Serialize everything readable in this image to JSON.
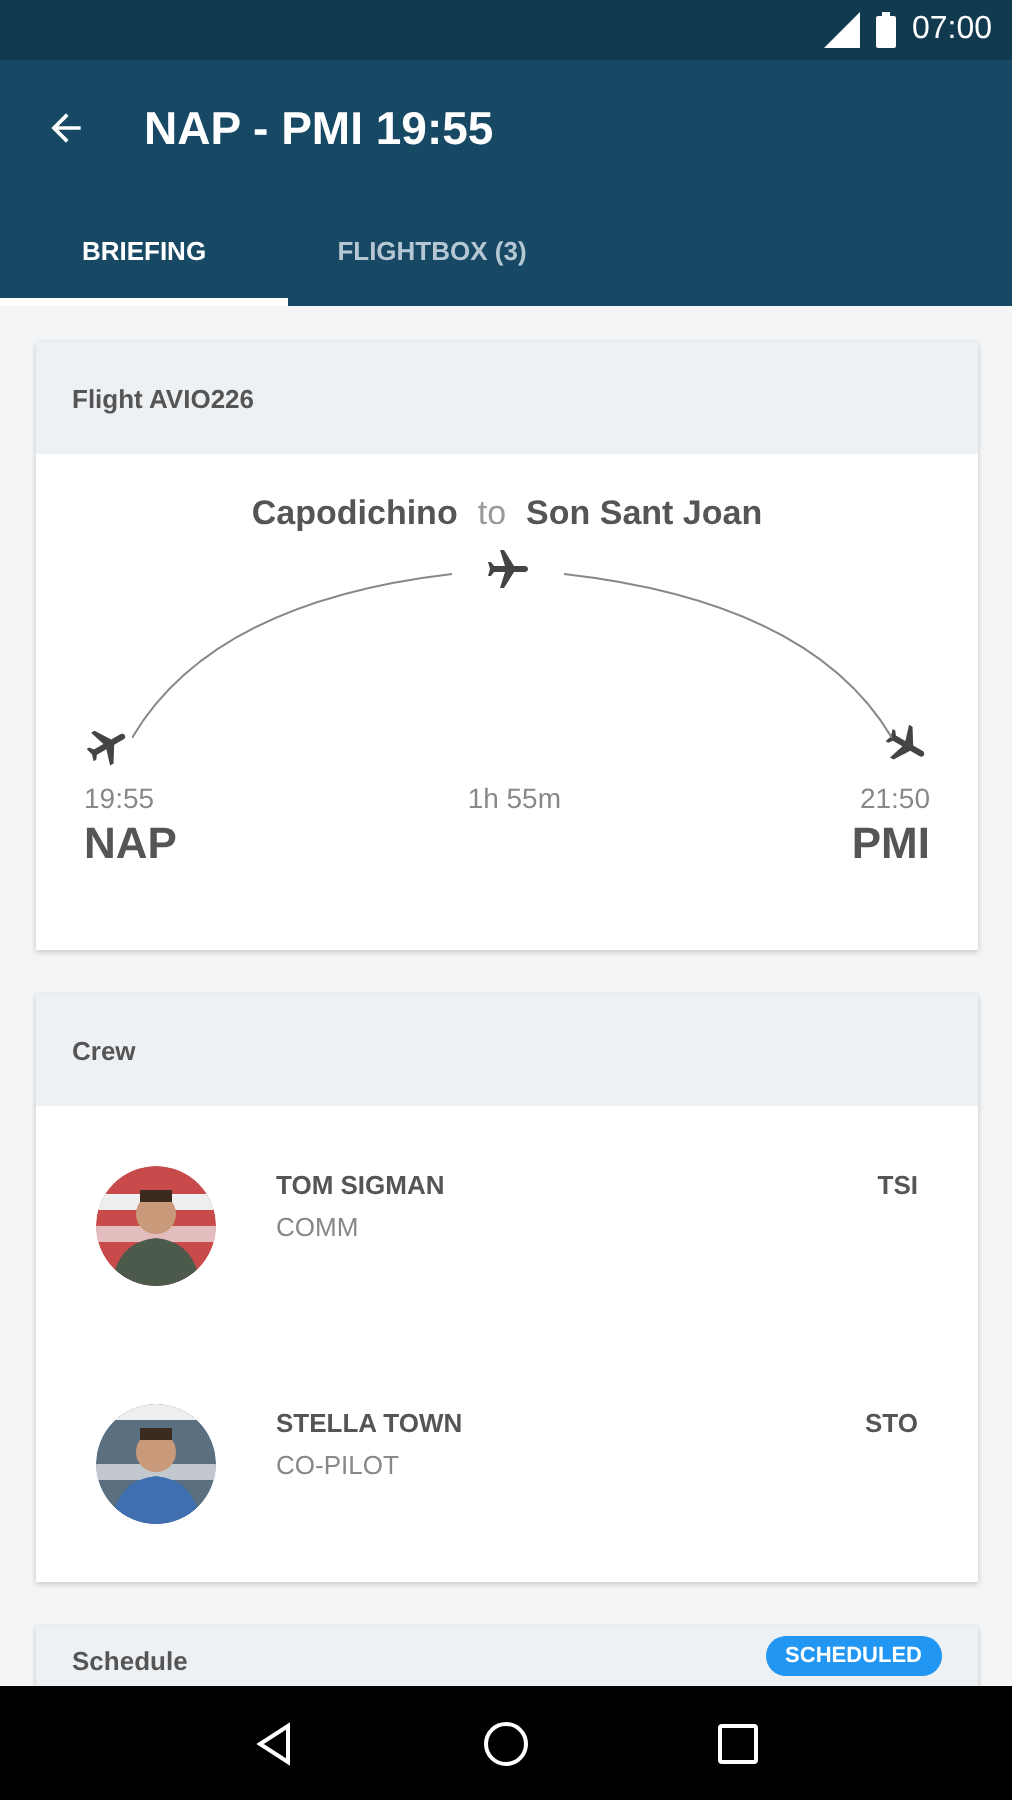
{
  "status_bar": {
    "time": "07:00"
  },
  "app_bar": {
    "title": "NAP - PMI 19:55"
  },
  "tabs": [
    {
      "label": "BRIEFING",
      "selected": true
    },
    {
      "label": "FLIGHTBOX (3)",
      "selected": false
    }
  ],
  "flight_card": {
    "title": "Flight AVIO226",
    "from_airport": "Capodichino",
    "connector": "to",
    "to_airport": "Son Sant Joan",
    "departure": {
      "time": "19:55",
      "code": "NAP"
    },
    "duration": "1h 55m",
    "arrival": {
      "time": "21:50",
      "code": "PMI"
    }
  },
  "crew_card": {
    "title": "Crew",
    "members": [
      {
        "name": "TOM SIGMAN",
        "role": "COMM",
        "code": "TSI"
      },
      {
        "name": "STELLA TOWN",
        "role": "CO-PILOT",
        "code": "STO"
      }
    ]
  },
  "schedule_card": {
    "title": "Schedule",
    "status": "SCHEDULED"
  }
}
